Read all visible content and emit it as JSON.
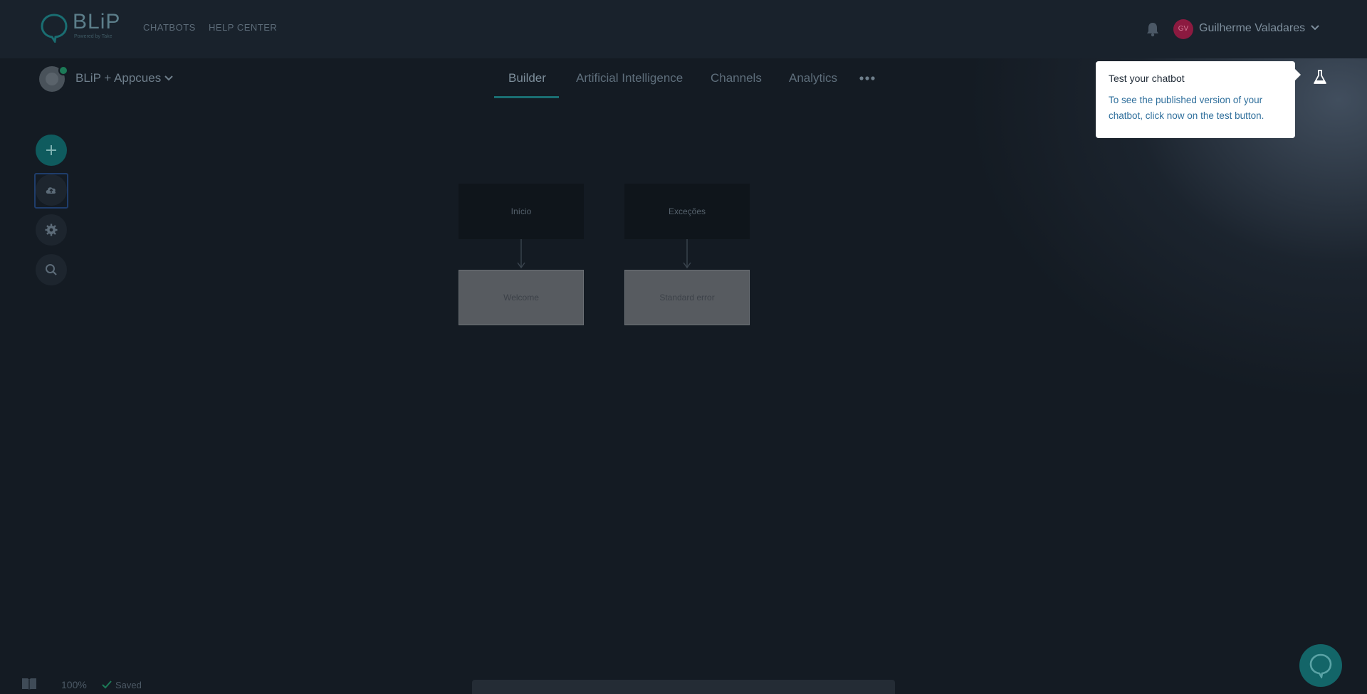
{
  "header": {
    "logo_text": "BLiP",
    "logo_subtitle": "Powered by Take",
    "nav": [
      {
        "label": "CHATBOTS"
      },
      {
        "label": "HELP CENTER"
      }
    ],
    "user": {
      "initials": "GV",
      "name": "Guilherme Valadares"
    }
  },
  "bot": {
    "name": "BLiP + Appcues"
  },
  "tabs": [
    {
      "label": "Builder",
      "active": true
    },
    {
      "label": "Artificial Intelligence",
      "active": false
    },
    {
      "label": "Channels",
      "active": false
    },
    {
      "label": "Analytics",
      "active": false
    }
  ],
  "icons": {
    "add": "plus-icon",
    "publish": "cloud-upload-icon",
    "settings": "gear-icon",
    "search": "search-icon",
    "notifications": "bell-icon",
    "more": "more-horizontal-icon",
    "test": "flask-icon",
    "help": "book-icon",
    "chat": "chat-bubble-icon"
  },
  "flow": {
    "nodes": [
      {
        "label": "Início"
      },
      {
        "label": "Exceções"
      },
      {
        "label": "Welcome"
      },
      {
        "label": "Standard error"
      }
    ]
  },
  "tooltip": {
    "title": "Test your chatbot",
    "body": "To see the published version of your chatbot, click now on the test button."
  },
  "footer": {
    "zoom": "100%",
    "status": "Saved"
  },
  "colors": {
    "accent": "#0f5b5e",
    "avatar": "#8c1a40",
    "link": "#2f6f9c"
  }
}
